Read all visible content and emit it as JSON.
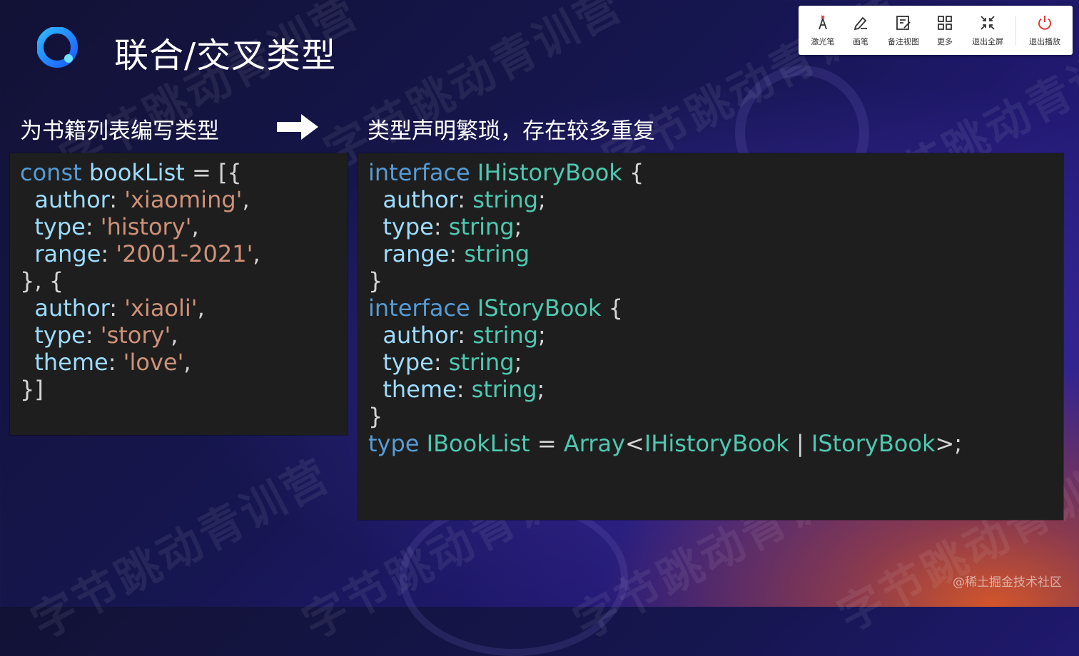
{
  "slide": {
    "title": "联合/交叉类型",
    "left_caption": "为书籍列表编写类型",
    "right_caption": "类型声明繁琐，存在较多重复",
    "watermark": "字节跳动青训营",
    "credit": "@稀土掘金技术社区"
  },
  "toolbar": {
    "items": [
      {
        "label": "激光笔",
        "icon": "laser-pointer-icon"
      },
      {
        "label": "画笔",
        "icon": "pen-icon"
      },
      {
        "label": "备注视图",
        "icon": "notes-view-icon"
      },
      {
        "label": "更多",
        "icon": "grid-more-icon"
      },
      {
        "label": "退出全屏",
        "icon": "exit-fullscreen-icon"
      },
      {
        "label": "退出播放",
        "icon": "power-icon"
      }
    ],
    "power_color": "#e53935",
    "laser_color": "#e53935"
  },
  "code_left": [
    [
      [
        "kw",
        "const "
      ],
      [
        "prop",
        "bookList"
      ],
      [
        "pun",
        " = [{"
      ]
    ],
    [
      [
        "pun",
        "  "
      ],
      [
        "prop",
        "author"
      ],
      [
        "pun",
        ": "
      ],
      [
        "str",
        "'xiaoming'"
      ],
      [
        "pun",
        ","
      ]
    ],
    [
      [
        "pun",
        "  "
      ],
      [
        "prop",
        "type"
      ],
      [
        "pun",
        ": "
      ],
      [
        "str",
        "'history'"
      ],
      [
        "pun",
        ","
      ]
    ],
    [
      [
        "pun",
        "  "
      ],
      [
        "prop",
        "range"
      ],
      [
        "pun",
        ": "
      ],
      [
        "str",
        "'2001-2021'"
      ],
      [
        "pun",
        ","
      ]
    ],
    [
      [
        "pun",
        "}, {"
      ]
    ],
    [
      [
        "pun",
        "  "
      ],
      [
        "prop",
        "author"
      ],
      [
        "pun",
        ": "
      ],
      [
        "str",
        "'xiaoli'"
      ],
      [
        "pun",
        ","
      ]
    ],
    [
      [
        "pun",
        "  "
      ],
      [
        "prop",
        "type"
      ],
      [
        "pun",
        ": "
      ],
      [
        "str",
        "'story'"
      ],
      [
        "pun",
        ","
      ]
    ],
    [
      [
        "pun",
        "  "
      ],
      [
        "prop",
        "theme"
      ],
      [
        "pun",
        ": "
      ],
      [
        "str",
        "'love'"
      ],
      [
        "pun",
        ","
      ]
    ],
    [
      [
        "pun",
        "}]"
      ]
    ]
  ],
  "code_right": [
    [
      [
        "kw",
        "interface "
      ],
      [
        "ty",
        "IHistoryBook"
      ],
      [
        "pun",
        " {"
      ]
    ],
    [
      [
        "pun",
        "  "
      ],
      [
        "prop",
        "author"
      ],
      [
        "pun",
        ": "
      ],
      [
        "ty",
        "string"
      ],
      [
        "pun",
        ";"
      ]
    ],
    [
      [
        "pun",
        "  "
      ],
      [
        "prop",
        "type"
      ],
      [
        "pun",
        ": "
      ],
      [
        "ty",
        "string"
      ],
      [
        "pun",
        ";"
      ]
    ],
    [
      [
        "pun",
        "  "
      ],
      [
        "prop",
        "range"
      ],
      [
        "pun",
        ": "
      ],
      [
        "ty",
        "string"
      ]
    ],
    [
      [
        "pun",
        "}"
      ]
    ],
    [
      [
        "kw",
        "interface "
      ],
      [
        "ty",
        "IStoryBook"
      ],
      [
        "pun",
        " {"
      ]
    ],
    [
      [
        "pun",
        "  "
      ],
      [
        "prop",
        "author"
      ],
      [
        "pun",
        ": "
      ],
      [
        "ty",
        "string"
      ],
      [
        "pun",
        ";"
      ]
    ],
    [
      [
        "pun",
        "  "
      ],
      [
        "prop",
        "type"
      ],
      [
        "pun",
        ": "
      ],
      [
        "ty",
        "string"
      ],
      [
        "pun",
        ";"
      ]
    ],
    [
      [
        "pun",
        "  "
      ],
      [
        "prop",
        "theme"
      ],
      [
        "pun",
        ": "
      ],
      [
        "ty",
        "string"
      ],
      [
        "pun",
        ";"
      ]
    ],
    [
      [
        "pun",
        "}"
      ]
    ],
    [
      [
        "kw",
        "type "
      ],
      [
        "ty",
        "IBookList"
      ],
      [
        "pun",
        " = "
      ],
      [
        "ty",
        "Array"
      ],
      [
        "pun",
        "<"
      ],
      [
        "ty",
        "IHistoryBook"
      ],
      [
        "pun",
        " | "
      ],
      [
        "ty",
        "IStoryBook"
      ],
      [
        "pun",
        ">;"
      ]
    ]
  ],
  "colors": {
    "keyword": "#569cd6",
    "type": "#4ec9b0",
    "property": "#9cdcfe",
    "string": "#ce9178",
    "code_bg": "#1e1e1e"
  }
}
